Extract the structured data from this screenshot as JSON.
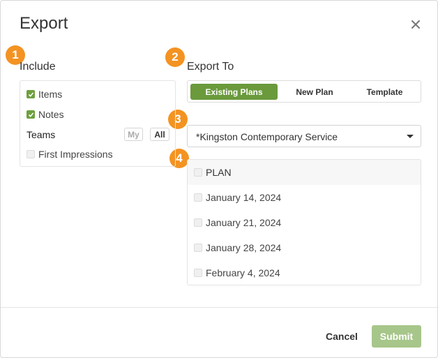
{
  "dialog": {
    "title": "Export",
    "close_icon": "close-icon"
  },
  "badges": [
    "1",
    "2",
    "3",
    "4"
  ],
  "include": {
    "label": "Include",
    "items": [
      {
        "label": "Items",
        "checked": true
      },
      {
        "label": "Notes",
        "checked": true
      }
    ],
    "teams": {
      "label": "Teams",
      "my_label": "My",
      "all_label": "All"
    },
    "first_impressions": {
      "label": "First Impressions",
      "checked": false
    }
  },
  "export_to": {
    "label": "Export To",
    "tabs": [
      {
        "label": "Existing Plans",
        "active": true
      },
      {
        "label": "New Plan",
        "active": false
      },
      {
        "label": "Template",
        "active": false
      }
    ],
    "service_type": {
      "selected": "*Kingston Contemporary Service"
    },
    "plans_header": "PLAN",
    "plans": [
      {
        "label": "January 14, 2024",
        "checked": false
      },
      {
        "label": "January 21, 2024",
        "checked": false
      },
      {
        "label": "January 28, 2024",
        "checked": false
      },
      {
        "label": "February 4, 2024",
        "checked": false
      }
    ]
  },
  "footer": {
    "cancel_label": "Cancel",
    "submit_label": "Submit"
  },
  "colors": {
    "accent": "#6a9a3c",
    "badge": "#f39322",
    "submit_disabled": "#a7c68a"
  }
}
